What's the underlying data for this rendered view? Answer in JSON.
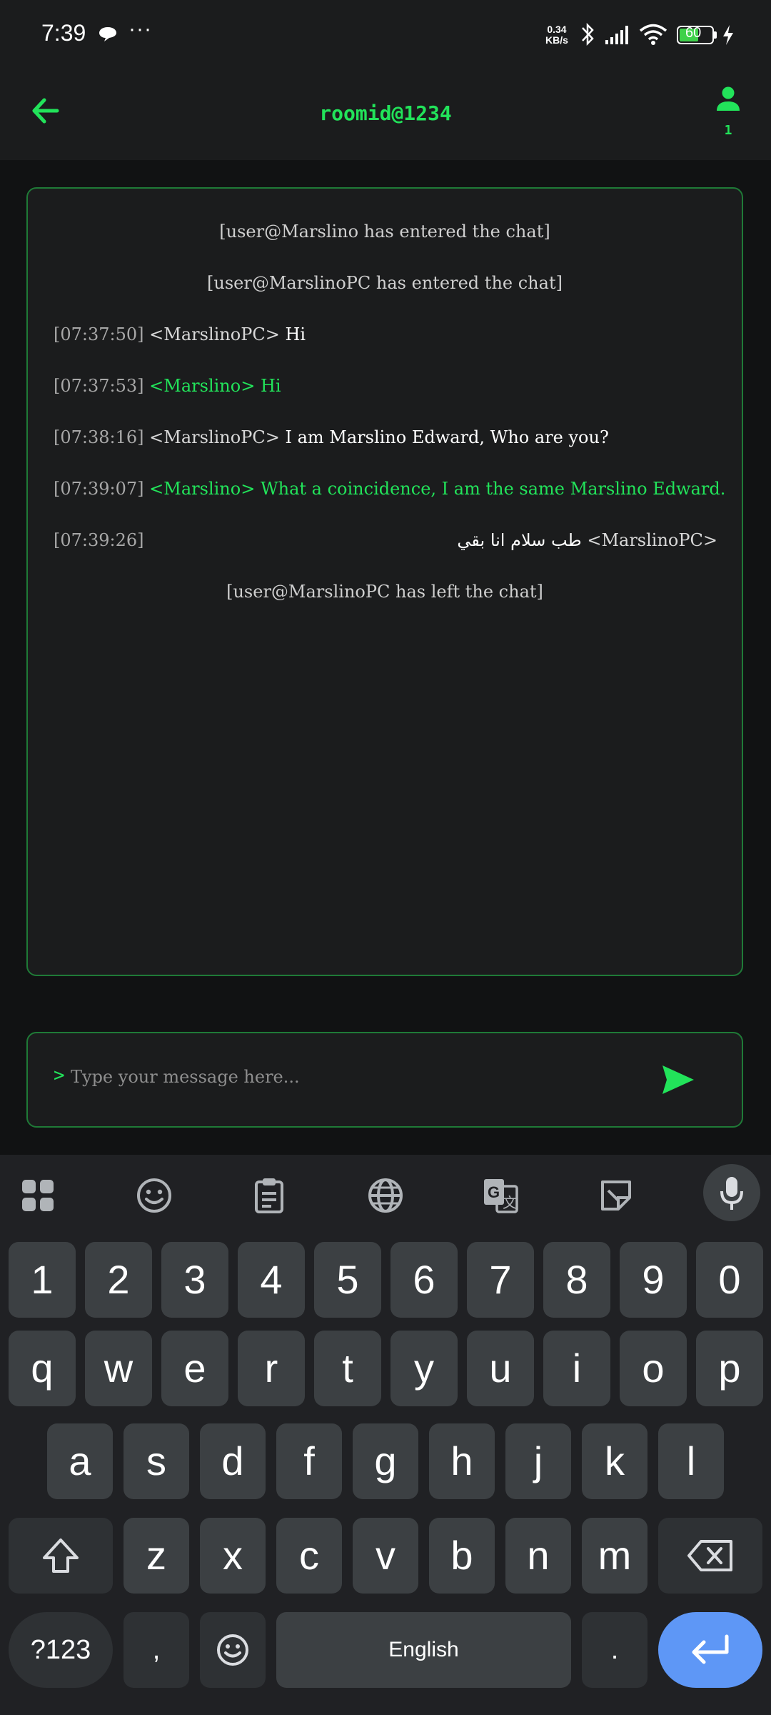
{
  "status_bar": {
    "time": "7:39",
    "dots": "···",
    "speed_value": "0.34",
    "speed_unit": "KB/s",
    "battery": "60",
    "battery_level": 0.6
  },
  "header": {
    "title": "roomid@1234",
    "user_count": "1"
  },
  "colors": {
    "accent": "#22e35a",
    "border": "#1f7a37",
    "background": "#111213",
    "panel": "#1b1c1d"
  },
  "chat": {
    "system_1": "[user@Marslino has entered the chat]",
    "system_2": "[user@MarslinoPC has entered the chat]",
    "m1": {
      "time": "[07:37:50]",
      "nick": "<MarslinoPC>",
      "text": "Hi"
    },
    "m2": {
      "time": "[07:37:53]",
      "nick": "<Marslino>",
      "text": "Hi"
    },
    "m3": {
      "time": "[07:38:16]",
      "nick": "<MarslinoPC>",
      "text": "I am Marslino Edward, Who are you?"
    },
    "m4": {
      "time": "[07:39:07]",
      "nick": "<Marslino>",
      "text": "What a coincidence, I am the same Marslino Edward."
    },
    "m5": {
      "time": "[07:39:26]",
      "nick": "<MarslinoPC>",
      "text": "طب سلام انا بقي"
    },
    "system_3": "[user@MarslinoPC has left the chat]"
  },
  "input": {
    "prompt": ">",
    "placeholder": "Type your message here...",
    "value": ""
  },
  "keyboard": {
    "toolbar_icons": [
      "apps-icon",
      "emoji-icon",
      "clipboard-icon",
      "globe-icon",
      "translate-icon",
      "sticker-icon",
      "mic-icon"
    ],
    "number_row": [
      "1",
      "2",
      "3",
      "4",
      "5",
      "6",
      "7",
      "8",
      "9",
      "0"
    ],
    "row1": [
      "q",
      "w",
      "e",
      "r",
      "t",
      "y",
      "u",
      "i",
      "o",
      "p"
    ],
    "row2": [
      "a",
      "s",
      "d",
      "f",
      "g",
      "h",
      "j",
      "k",
      "l"
    ],
    "row3": [
      "z",
      "x",
      "c",
      "v",
      "b",
      "n",
      "m"
    ],
    "sym_label": "?123",
    "comma": ",",
    "space_label": "English",
    "period": "."
  }
}
